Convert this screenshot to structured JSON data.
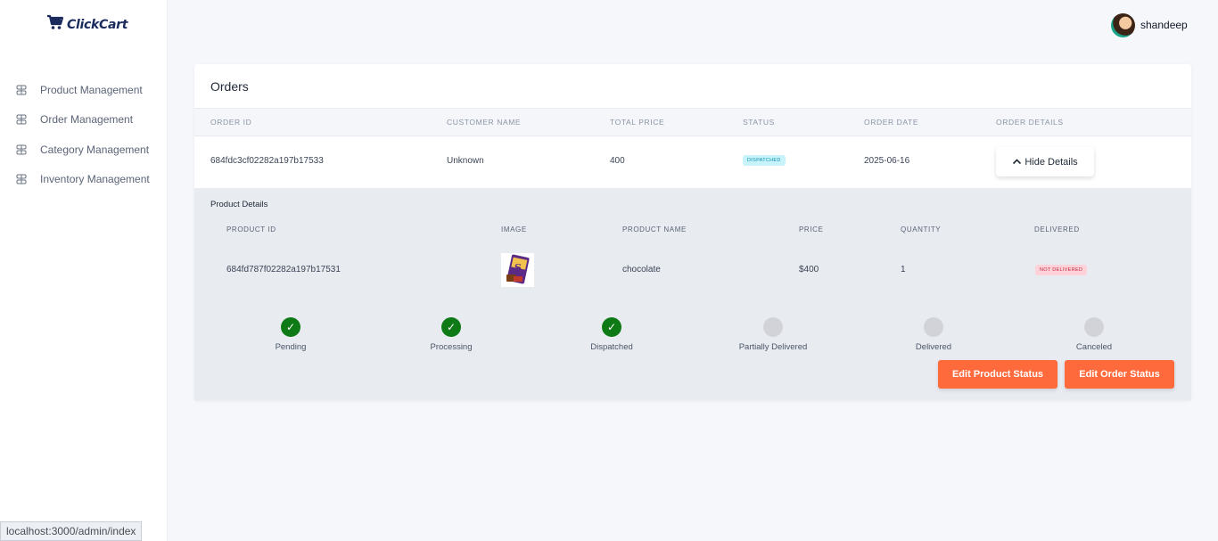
{
  "app": {
    "logo_text": "ClickCart"
  },
  "sidebar": {
    "items": [
      {
        "label": "Product Management"
      },
      {
        "label": "Order Management"
      },
      {
        "label": "Category Management"
      },
      {
        "label": "Inventory Management"
      }
    ]
  },
  "user": {
    "name": "shandeep"
  },
  "orders": {
    "title": "Orders",
    "columns": [
      "ORDER ID",
      "CUSTOMER NAME",
      "TOTAL PRICE",
      "STATUS",
      "ORDER DATE",
      "ORDER DETAILS"
    ],
    "row": {
      "order_id": "684fdc3cf02282a197b17533",
      "customer_name": "Unknown",
      "total_price": "400",
      "status": "DISPATCHED",
      "order_date": "2025-06-16",
      "details_button": "Hide Details"
    }
  },
  "product_details": {
    "title": "Product Details",
    "columns": [
      "PRODUCT ID",
      "IMAGE",
      "PRODUCT NAME",
      "PRICE",
      "QUANTITY",
      "DELIVERED"
    ],
    "row": {
      "product_id": "684fd787f02282a197b17531",
      "product_name": "chocolate",
      "price": "$400",
      "quantity": "1",
      "delivered": "NOT DELIVERED"
    },
    "steps": [
      {
        "label": "Pending",
        "done": true
      },
      {
        "label": "Processing",
        "done": true
      },
      {
        "label": "Dispatched",
        "done": true
      },
      {
        "label": "Partially Delivered",
        "done": false
      },
      {
        "label": "Delivered",
        "done": false
      },
      {
        "label": "Canceled",
        "done": false
      }
    ],
    "buttons": {
      "edit_product_status": "Edit Product Status",
      "edit_order_status": "Edit Order Status"
    }
  },
  "status_bar": {
    "url": "localhost:3000/admin/index"
  },
  "colors": {
    "accent_orange": "#ff6a3d",
    "step_done": "#0e7a16",
    "step_todo": "#d1d3d8",
    "brand_navy": "#1a2a5c"
  }
}
